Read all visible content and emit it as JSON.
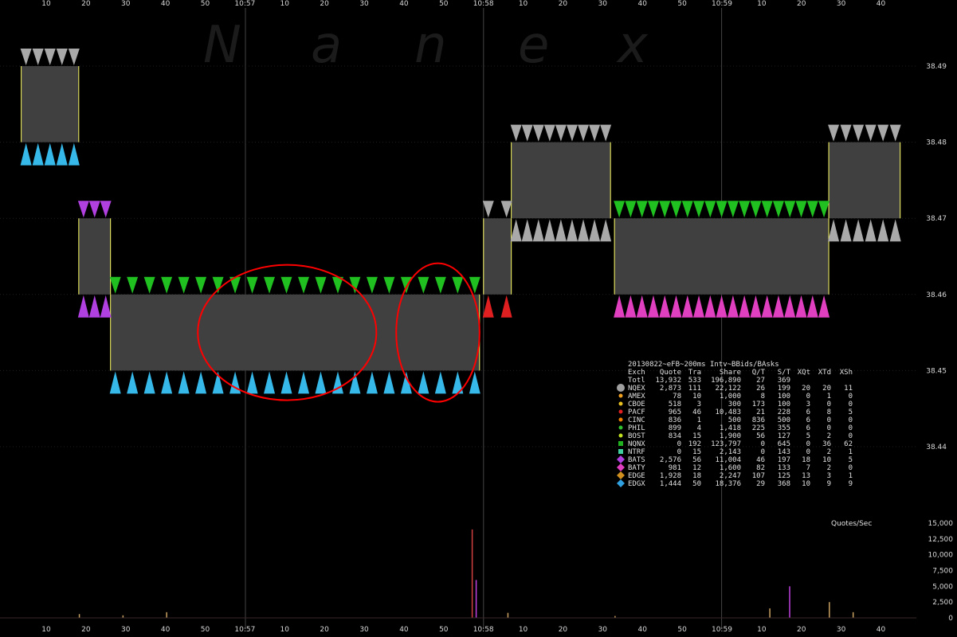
{
  "watermark": [
    "N",
    "a",
    "n",
    "e",
    "x"
  ],
  "colors": {
    "background": "#000000",
    "grid": "#1e1e1e",
    "spread_fill": "#404040",
    "bid_marker": "#36b8e8",
    "ask_marker": "#a9a9a9",
    "annotation": "#ff0000",
    "trade_line": "#ffff66"
  },
  "chart_data": {
    "type": "area",
    "title": "20130822~eFB~200ms Intv~BBids/BAsks",
    "x_time_labels": [
      "10:57",
      "10:58",
      "10:59"
    ],
    "x_second_labels": [
      "10",
      "20",
      "30",
      "40",
      "50",
      "10:57",
      "10",
      "20",
      "30",
      "40",
      "50",
      "10:58",
      "10",
      "20",
      "30",
      "40",
      "50",
      "10:59",
      "10",
      "20",
      "30",
      "40"
    ],
    "y_price_ticks": [
      "38.49",
      "38.48",
      "38.47",
      "38.46",
      "38.45",
      "38.44"
    ],
    "ylim": [
      38.43,
      38.5
    ],
    "nbbo": [
      {
        "t": "10:56:03.5",
        "t_end": "10:56:18",
        "bid": 38.48,
        "ask": 38.49
      },
      {
        "t": "10:56:18",
        "t_end": "10:56:26",
        "bid": 38.46,
        "ask": 38.47
      },
      {
        "t": "10:56:26",
        "t_end": "10:57:59",
        "bid": 38.45,
        "ask": 38.46
      },
      {
        "t": "10:58:00",
        "t_end": "10:58:07",
        "bid": 38.46,
        "ask": 38.47
      },
      {
        "t": "10:58:07",
        "t_end": "10:58:32",
        "bid": 38.47,
        "ask": 38.48
      },
      {
        "t": "10:58:33",
        "t_end": "10:59:27",
        "bid": 38.46,
        "ask": 38.47
      },
      {
        "t": "10:59:27",
        "t_end": "10:59:45",
        "bid": 38.47,
        "ask": 38.48
      }
    ],
    "volume_panel": {
      "label": "Quotes/Sec",
      "y_ticks": [
        "15,000",
        "12,500",
        "10,000",
        "7,500",
        "5,000",
        "2,500",
        "0"
      ],
      "ylim": [
        0,
        15000
      ],
      "bars": [
        {
          "t": "10:56:18",
          "v": 600
        },
        {
          "t": "10:56:29",
          "v": 400
        },
        {
          "t": "10:56:40",
          "v": 900
        },
        {
          "t": "10:57:57",
          "v": 14000
        },
        {
          "t": "10:57:58",
          "v": 6000
        },
        {
          "t": "10:58:06",
          "v": 800
        },
        {
          "t": "10:58:33",
          "v": 300
        },
        {
          "t": "10:59:17",
          "v": 5000
        },
        {
          "t": "10:59:12",
          "v": 1500
        },
        {
          "t": "10:59:27",
          "v": 2500
        },
        {
          "t": "10:59:33",
          "v": 900
        }
      ]
    },
    "table": {
      "headers": [
        "Exch",
        "Quote",
        "Tra",
        "Share",
        "Q/T",
        "S/T",
        "XQt",
        "XTd",
        "XSh"
      ],
      "total": [
        "Totl",
        "13,932",
        "533",
        "196,890",
        "27",
        "369",
        "",
        "",
        ""
      ],
      "rows": [
        {
          "cells": [
            "NQEX",
            "2,873",
            "111",
            "22,122",
            "26",
            "199",
            "20",
            "20",
            "11"
          ],
          "color": "#a0a0a0",
          "marker": "circle-big"
        },
        {
          "cells": [
            "AMEX",
            "78",
            "10",
            "1,000",
            "8",
            "100",
            "0",
            "1",
            "0"
          ],
          "color": "#f0a020",
          "marker": "dot"
        },
        {
          "cells": [
            "CBOE",
            "518",
            "3",
            "300",
            "173",
            "100",
            "3",
            "0",
            "0"
          ],
          "color": "#e8c020",
          "marker": "dot"
        },
        {
          "cells": [
            "PACF",
            "965",
            "46",
            "10,483",
            "21",
            "228",
            "6",
            "8",
            "5"
          ],
          "color": "#e02020",
          "marker": "dot"
        },
        {
          "cells": [
            "CINC",
            "836",
            "1",
            "500",
            "836",
            "500",
            "6",
            "0",
            "0"
          ],
          "color": "#f08000",
          "marker": "dot"
        },
        {
          "cells": [
            "PHIL",
            "899",
            "4",
            "1,418",
            "225",
            "355",
            "6",
            "0",
            "0"
          ],
          "color": "#30c030",
          "marker": "dot"
        },
        {
          "cells": [
            "BOST",
            "834",
            "15",
            "1,900",
            "56",
            "127",
            "5",
            "2",
            "0"
          ],
          "color": "#c0e020",
          "marker": "dot"
        },
        {
          "cells": [
            "NQNX",
            "0",
            "192",
            "123,797",
            "0",
            "645",
            "0",
            "36",
            "62"
          ],
          "color": "#20b020",
          "marker": "square"
        },
        {
          "cells": [
            "NTRF",
            "0",
            "15",
            "2,143",
            "0",
            "143",
            "0",
            "2",
            "1"
          ],
          "color": "#40d0a0",
          "marker": "square"
        },
        {
          "cells": [
            "BATS",
            "2,576",
            "56",
            "11,004",
            "46",
            "197",
            "18",
            "10",
            "5"
          ],
          "color": "#b040e0",
          "marker": "diamond"
        },
        {
          "cells": [
            "BATY",
            "981",
            "12",
            "1,600",
            "82",
            "133",
            "7",
            "2",
            "0"
          ],
          "color": "#e040c0",
          "marker": "diamond"
        },
        {
          "cells": [
            "EDGE",
            "1,928",
            "18",
            "2,247",
            "107",
            "125",
            "13",
            "3",
            "1"
          ],
          "color": "#d09020",
          "marker": "diamond"
        },
        {
          "cells": [
            "EDGX",
            "1,444",
            "50",
            "18,376",
            "29",
            "368",
            "10",
            "9",
            "9"
          ],
          "color": "#30a0e0",
          "marker": "diamond"
        }
      ]
    },
    "annotations": [
      {
        "shape": "ellipse",
        "from": "10:56:48",
        "to": "10:57:33",
        "bid": 38.45,
        "ask": 38.46
      },
      {
        "shape": "ellipse",
        "from": "10:57:38",
        "to": "10:57:59",
        "bid": 38.45,
        "ask": 38.46
      }
    ]
  }
}
